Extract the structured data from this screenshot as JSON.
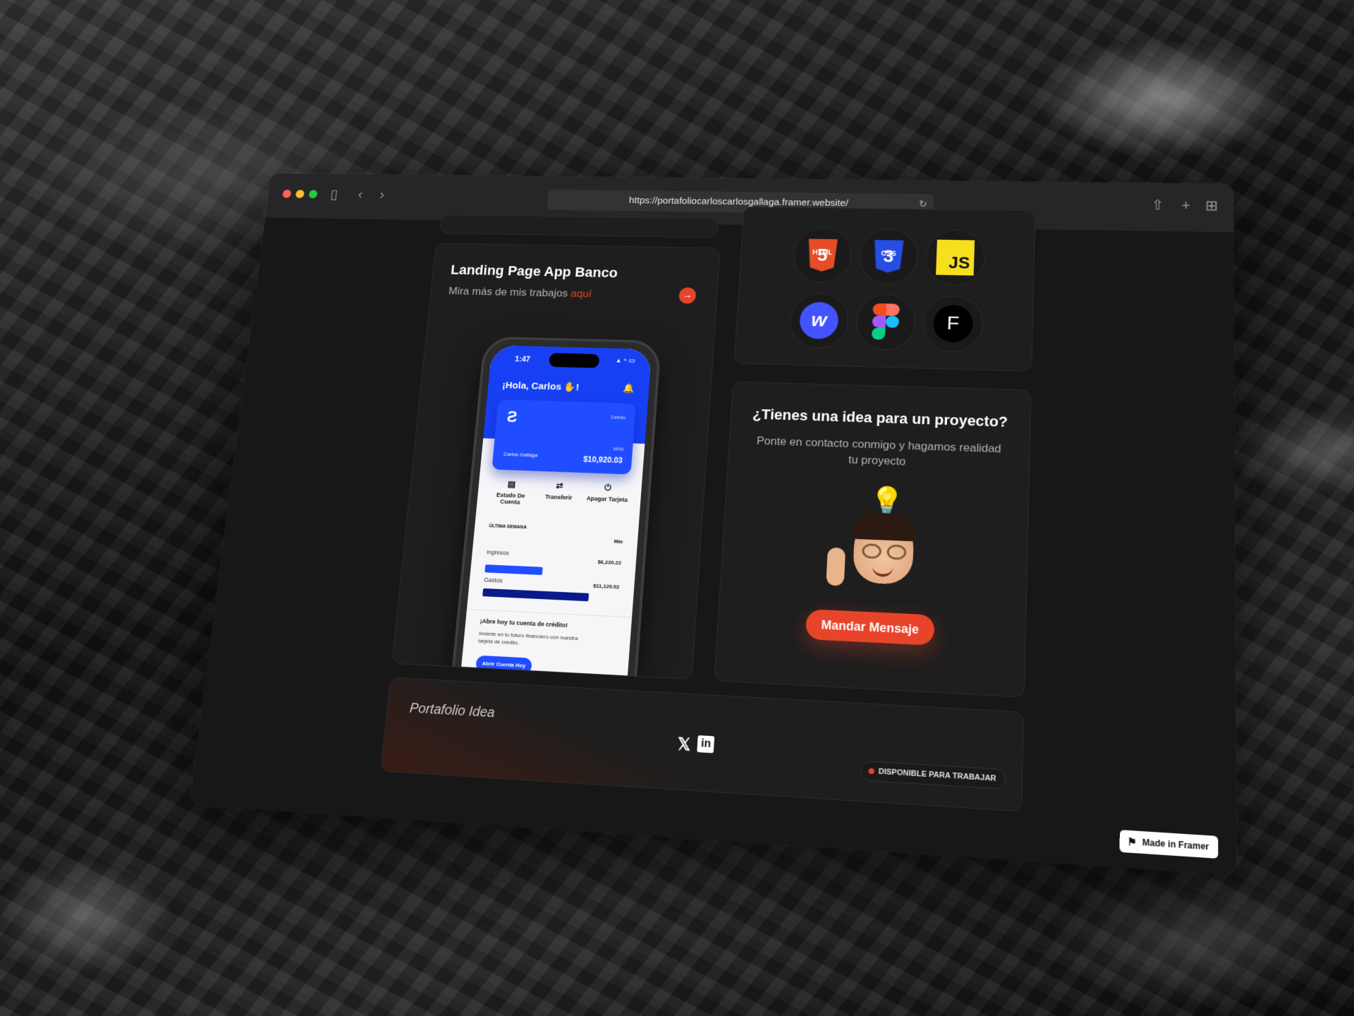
{
  "browser": {
    "url": "https://portafoliocarloscarlosgallaga.framer.website/",
    "icons": [
      "sidebar-icon",
      "back-icon",
      "forward-icon",
      "reload-icon",
      "share-icon",
      "new-tab-icon",
      "tab-overview-icon"
    ]
  },
  "project": {
    "title": "Landing Page App Banco",
    "subtitle_prefix": "Mira más de mis trabajos",
    "subtitle_link": "aquí",
    "phone": {
      "time": "1:47",
      "greeting": "¡Hola, Carlos ✋!",
      "card_type": "Débito",
      "card_holder": "Carlos Gallaga",
      "currency": "MXN",
      "balance": "$10,920.03",
      "actions": [
        "Estado De Cuenta",
        "Transferir",
        "Apagar Tarjeta"
      ],
      "week_label": "ÚLTIMA SEMANA",
      "more_label": "Más",
      "income_label": "Ingresos",
      "income_value": "$6,220.22",
      "income_share": 0.45,
      "expense_label": "Gastos",
      "expense_value": "$11,120.02",
      "expense_share": 0.82,
      "promo_title": "¡Abre hoy tu cuenta de crédito!",
      "promo_text": "Invierte en tu futuro financiero con nuestra tarjeta de crédito.",
      "promo_button": "Abrir Cuenta Hoy"
    }
  },
  "skills": {
    "items": [
      {
        "name": "HTML",
        "tag": "HTML",
        "glyph": "5"
      },
      {
        "name": "CSS",
        "tag": "CSS",
        "glyph": "3"
      },
      {
        "name": "JavaScript",
        "glyph": "JS"
      },
      {
        "name": "Webflow",
        "glyph": "w"
      },
      {
        "name": "Figma"
      },
      {
        "name": "Framer",
        "glyph": "F"
      }
    ]
  },
  "cta": {
    "title": "¿Tienes una idea para un proyecto?",
    "subtitle": "Ponte en contacto conmigo y hagamos realidad tu proyecto",
    "button": "Mandar Mensaje"
  },
  "footer": {
    "brand": "Portafolio Idea",
    "social": [
      "x-icon",
      "linkedin-icon"
    ],
    "availability": "DISPONIBLE PARA TRABAJAR"
  },
  "badge": {
    "label": "Made in Framer"
  },
  "colors": {
    "accent": "#e8442a",
    "bank_blue": "#1f4dff",
    "page_bg": "#171717"
  }
}
